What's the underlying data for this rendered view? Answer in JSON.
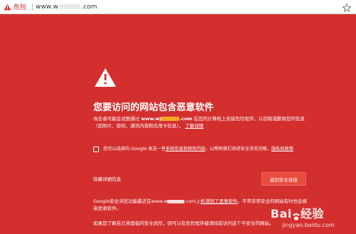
{
  "address_bar": {
    "danger_label": "危险",
    "url_prefix": "www.w",
    "url_suffix": ".com"
  },
  "warning": {
    "title": "您要访问的网站包含恶意软件",
    "desc_part1": "攻击者可能会试图通过",
    "desc_domain_prefix": "www.wj",
    "desc_domain_suffix": ".com",
    "desc_part2": "在您的计算机上安装危险程序，以窃取或删除您的信息（如照片、密码、通讯内容和信用卡信息）。",
    "learn_more": "了解详情",
    "checkbox_text_part1": "您可以选择向 Google 发送一些",
    "checkbox_link": "系统信息和网页内容",
    "checkbox_text_part2": "，以帮助我们改进安全浏览功能。",
    "privacy_link": "隐私权政策",
    "hide_details": "隐藏详细信息",
    "back_button": "返回安全连接",
    "details_part1": "Google安全浏览功能最近在www.w",
    "details_part2": ".com上",
    "details_link": "检测到了恶意软件",
    "details_part3": "。平常非常安全的网站有时也会感染恶意软件。",
    "details_para2": "如果您了解自己将面临的安全风险，则可以在危险程序被清除前访问这个不安全的网站。"
  },
  "watermark": {
    "logo_left": "Bai",
    "logo_right": "经验",
    "sub": "jingyan.baidu.com"
  },
  "colors": {
    "background": "#d32f2f",
    "button": "#e84a3e",
    "address_bar": "#ffffff"
  }
}
